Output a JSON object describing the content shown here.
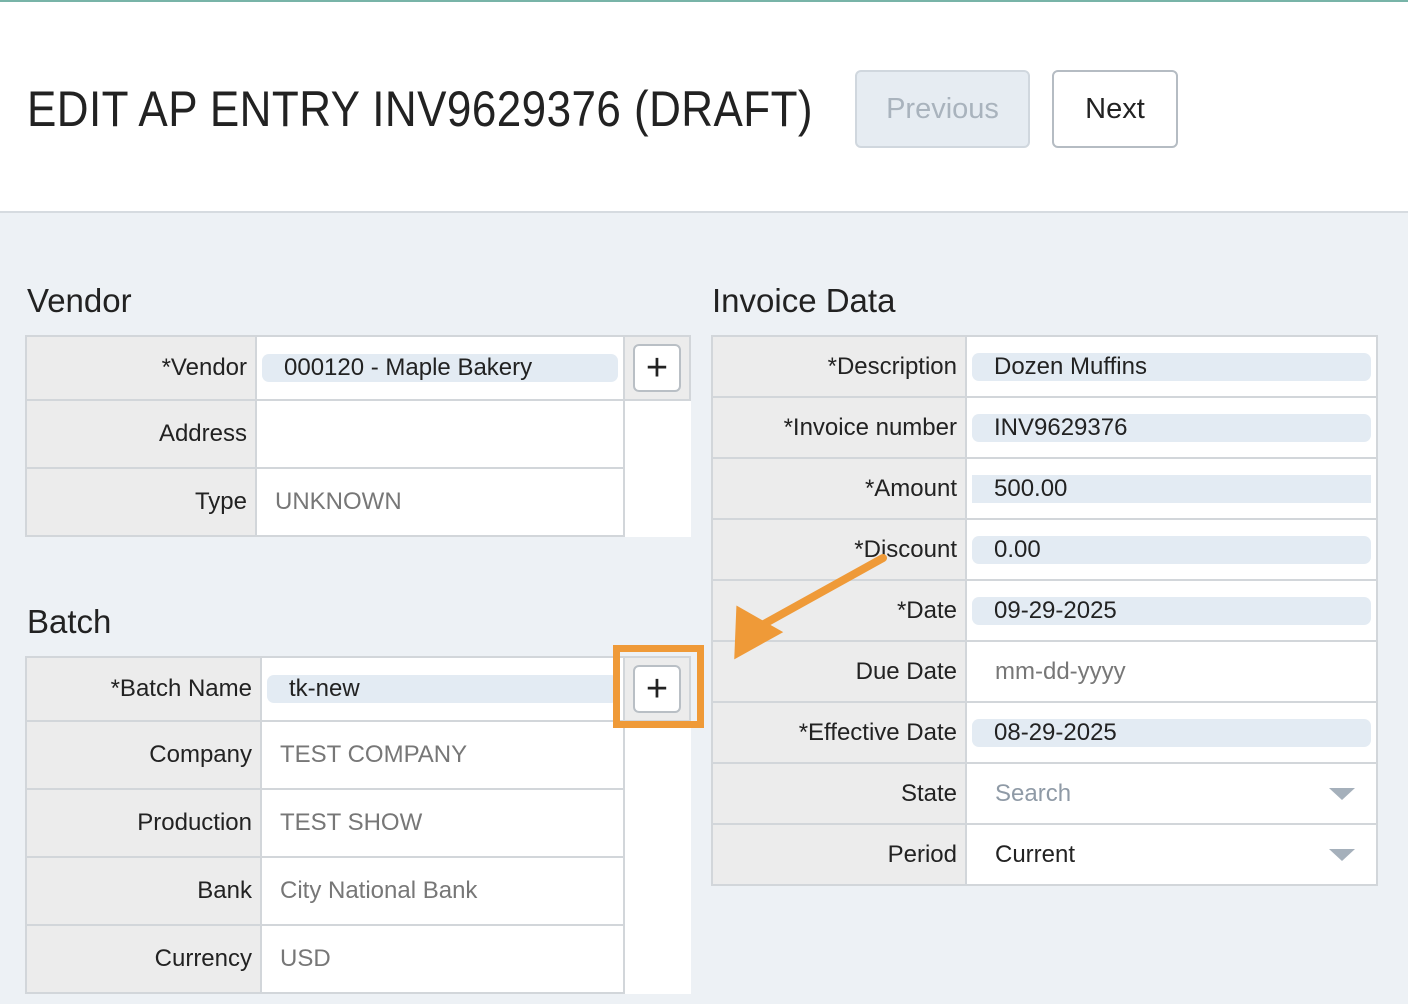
{
  "header": {
    "title": "EDIT AP ENTRY INV9629376 (DRAFT)",
    "previous_label": "Previous",
    "next_label": "Next"
  },
  "vendor": {
    "title": "Vendor",
    "rows": [
      {
        "label": "*Vendor",
        "value": "000120 - Maple Bakery"
      },
      {
        "label": "Address",
        "value": ""
      },
      {
        "label": "Type",
        "value": "UNKNOWN"
      }
    ],
    "add_label": "+"
  },
  "batch": {
    "title": "Batch",
    "rows": [
      {
        "label": "*Batch Name",
        "value": "tk-new"
      },
      {
        "label": "Company",
        "value": "TEST COMPANY"
      },
      {
        "label": "Production",
        "value": "TEST SHOW"
      },
      {
        "label": "Bank",
        "value": "City National Bank"
      },
      {
        "label": "Currency",
        "value": "USD"
      }
    ],
    "add_label": "+"
  },
  "invoice": {
    "title": "Invoice Data",
    "rows": [
      {
        "label": "*Description",
        "value": "Dozen Muffins"
      },
      {
        "label": "*Invoice number",
        "value": "INV9629376"
      },
      {
        "label": "*Amount",
        "value": "500.00"
      },
      {
        "label": "*Discount",
        "value": "0.00"
      },
      {
        "label": "*Date",
        "value": "09-29-2025"
      },
      {
        "label": "Due Date",
        "placeholder": "mm-dd-yyyy"
      },
      {
        "label": "*Effective Date",
        "value": "08-29-2025"
      },
      {
        "label": "State",
        "placeholder": "Search"
      },
      {
        "label": "Period",
        "value": "Current"
      }
    ]
  },
  "colors": {
    "highlight": "#ef9a38",
    "field_fill": "#e3ebf3",
    "label_fill": "#ececec",
    "background": "#edf1f5"
  },
  "icons": [
    "plus-icon",
    "chevron-down-icon",
    "arrow-annotation"
  ]
}
